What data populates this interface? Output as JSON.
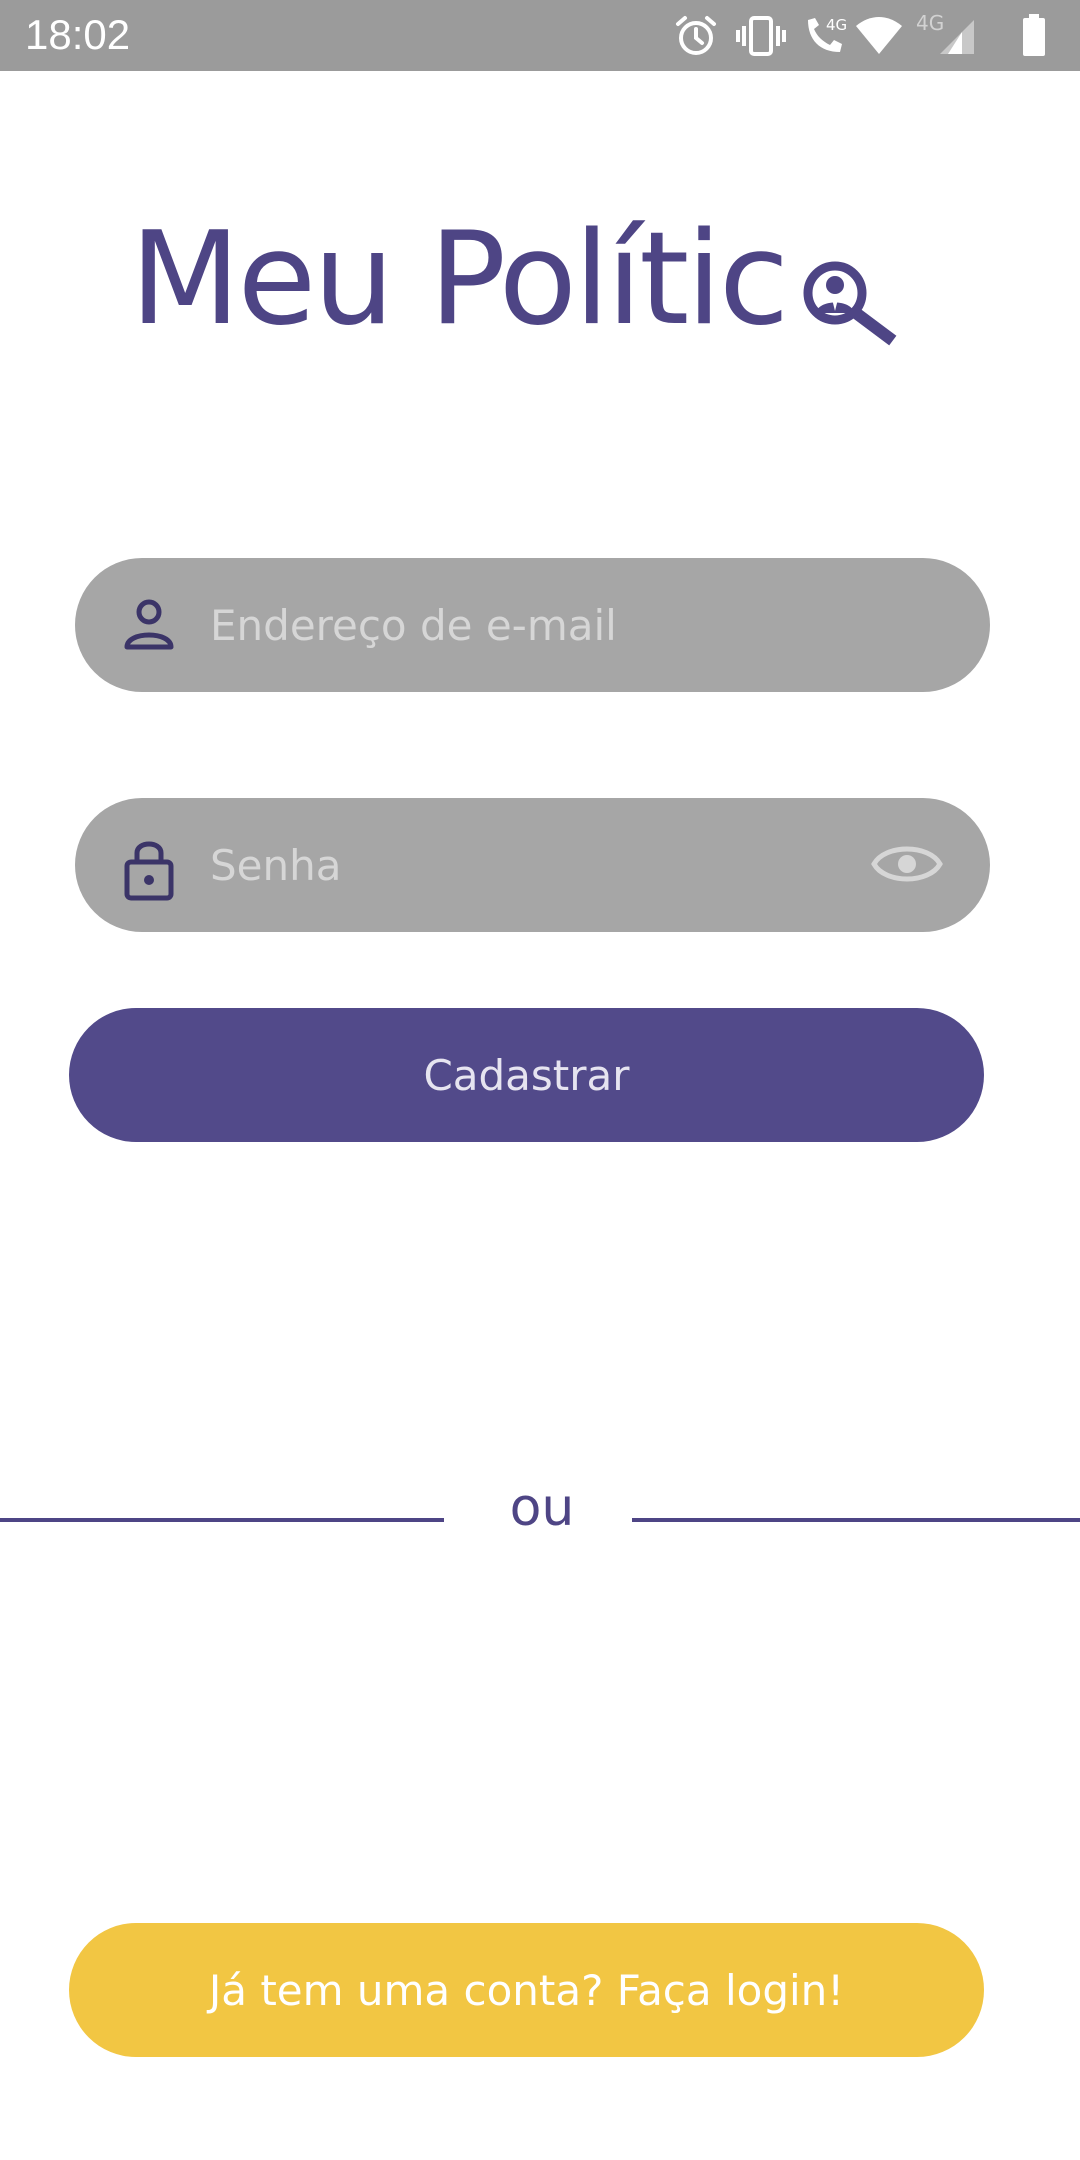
{
  "status_bar": {
    "time": "18:02",
    "icons": [
      "alarm-icon",
      "vibrate-icon",
      "volte-call-icon",
      "wifi-icon",
      "cell-signal-icon",
      "battery-icon"
    ],
    "call_label": "4G",
    "signal_label": "4G"
  },
  "logo": {
    "text": "Meu Polític",
    "icon": "magnifier-politician-icon"
  },
  "form": {
    "email_placeholder": "Endereço de e-mail",
    "email_value": "",
    "password_placeholder": "Senha",
    "password_value": "",
    "submit_label": "Cadastrar"
  },
  "divider": {
    "label": "ou"
  },
  "login_button_label": "Já tem uma conta? Faça login!",
  "colors": {
    "primary": "#524a8a",
    "field_bg": "#a6a6a6",
    "accent": "#f2c643",
    "status_bar": "#9b9b9b"
  }
}
